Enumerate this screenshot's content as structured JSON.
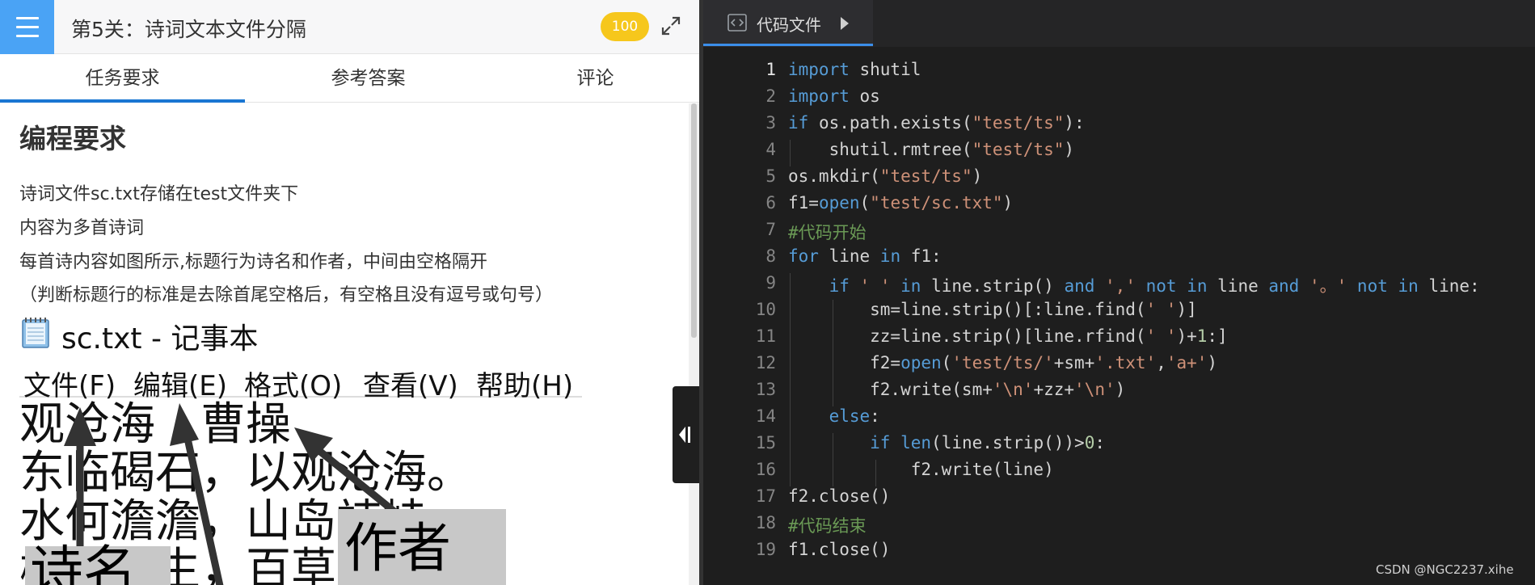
{
  "header": {
    "title": "第5关：诗词文本文件分隔",
    "score": "100"
  },
  "tabs": [
    {
      "label": "任务要求"
    },
    {
      "label": "参考答案"
    },
    {
      "label": "评论"
    }
  ],
  "task": {
    "heading": "编程要求",
    "lines": [
      "诗词文件sc.txt存储在test文件夹下",
      "内容为多首诗词",
      "每首诗内容如图所示,标题行为诗名和作者，中间由空格隔开",
      "（判断标题行的标准是去除首尾空格后，有空格且没有逗号或句号）"
    ]
  },
  "notepad": {
    "title": "sc.txt - 记事本",
    "menus": [
      "文件(F)",
      "编辑(E)",
      "格式(O)",
      "查看(V)",
      "帮助(H)"
    ],
    "lines": [
      "观沧海　曹操",
      "东临碣石，以观沧海。",
      "水何澹澹，山岛竦峙。",
      "树木丛生，百草丰茂。"
    ],
    "labels": [
      "诗名",
      "作者"
    ]
  },
  "editor": {
    "tab_label": "代码文件",
    "line_numbers": [
      "1",
      "2",
      "3",
      "4",
      "5",
      "6",
      "7",
      "8",
      "9",
      "10",
      "11",
      "12",
      "13",
      "14",
      "15",
      "16",
      "17",
      "18",
      "19"
    ],
    "active_line": 1,
    "lines": [
      "import shutil",
      "import os",
      "if os.path.exists(\"test/ts\"):",
      "    shutil.rmtree(\"test/ts\")",
      "os.mkdir(\"test/ts\")",
      "f1=open(\"test/sc.txt\")",
      "#代码开始",
      "for line in f1:",
      "    if ' ' in line.strip() and ',' not in line and '。' not in line:",
      "        sm=line.strip()[:line.find(' ')]",
      "        zz=line.strip()[line.rfind(' ')+1:]",
      "        f2=open('test/ts/'+sm+'.txt','a+')",
      "        f2.write(sm+'\\n'+zz+'\\n')",
      "    else:",
      "        if len(line.strip())>0:",
      "            f2.write(line)",
      "f2.close()",
      "#代码结束",
      "f1.close()"
    ]
  },
  "watermark": "CSDN @NGC2237.xihe",
  "colors": {
    "accent": "#4aa3f5",
    "score_badge": "#f6c71c",
    "tab_underline": "#1976d2",
    "editor_bg": "#1e1e1e",
    "keyword": "#569cd6",
    "string": "#ce9178",
    "comment": "#6a9955"
  },
  "icons": {
    "menu": "hamburger-icon",
    "expand": "expand-icon",
    "collapse": "collapse-left-icon",
    "file": "code-file-icon"
  }
}
